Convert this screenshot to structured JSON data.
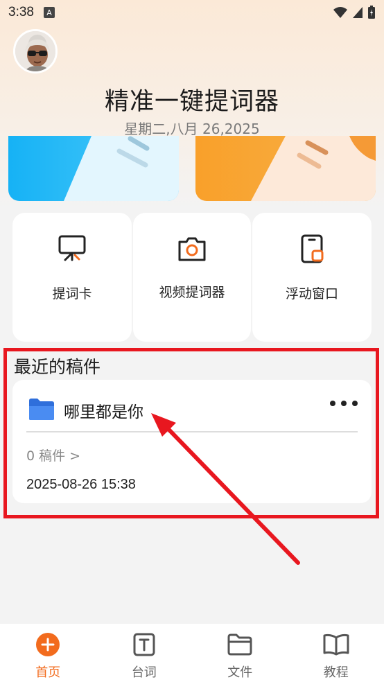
{
  "status_bar": {
    "time": "3:38",
    "notif_glyph": "A"
  },
  "header": {
    "title": "精准一键提词器",
    "date": "星期二,八月 26,2025"
  },
  "tools": [
    {
      "label": "提词卡",
      "icon": "presentation-board-icon"
    },
    {
      "label": "视频提词器",
      "icon": "camera-icon"
    },
    {
      "label": "浮动窗口",
      "icon": "floating-window-icon"
    }
  ],
  "recent": {
    "title": "最近的稿件",
    "card": {
      "name": "哪里都是你",
      "count": "0 稿件 >",
      "date": "2025-08-26 15:38"
    }
  },
  "nav": [
    {
      "label": "首页",
      "icon": "home-plus-icon",
      "active": true
    },
    {
      "label": "台词",
      "icon": "script-t-icon",
      "active": false
    },
    {
      "label": "文件",
      "icon": "folder-icon",
      "active": false
    },
    {
      "label": "教程",
      "icon": "book-icon",
      "active": false
    }
  ],
  "colors": {
    "accent": "#f26b1d",
    "highlight": "#e8171f",
    "folder": "#3b82f6"
  }
}
